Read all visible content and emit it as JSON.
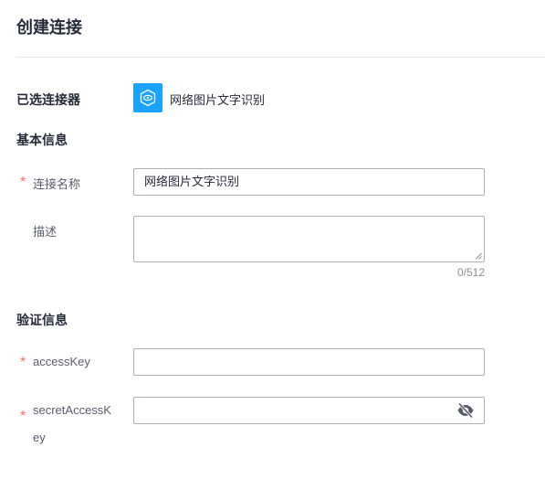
{
  "page": {
    "title": "创建连接"
  },
  "selected_connector": {
    "label": "已选连接器",
    "name": "网络图片文字识别",
    "icon": "eye-scan-icon",
    "icon_color": "#1aa3ff"
  },
  "basic_info": {
    "title": "基本信息",
    "connection_name": {
      "label": "连接名称",
      "required": "*",
      "value": "网络图片文字识别"
    },
    "description": {
      "label": "描述",
      "value": "",
      "counter": "0/512"
    }
  },
  "auth_info": {
    "title": "验证信息",
    "access_key": {
      "label": "accessKey",
      "required": "*",
      "value": ""
    },
    "secret_access_key": {
      "label_line1": "secretAccessK",
      "label_line2": "ey",
      "required": "*",
      "value": "",
      "toggle_icon": "eye-hidden-icon"
    }
  },
  "colors": {
    "required": "#f66f6a",
    "accent": "#1aa3ff",
    "border": "#adb0b8"
  }
}
